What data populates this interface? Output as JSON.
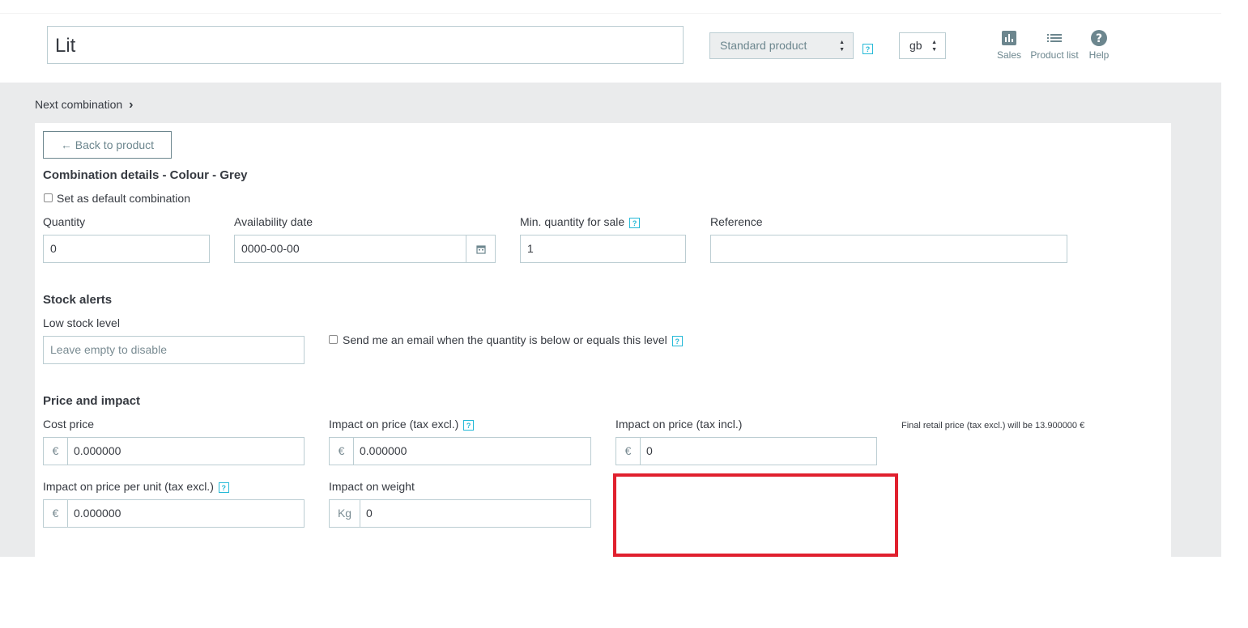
{
  "header": {
    "product_name": "Lit",
    "product_type": "Standard product",
    "language": "gb",
    "tools": {
      "sales": "Sales",
      "product_list": "Product list",
      "help": "Help"
    },
    "help_marker": "?"
  },
  "nav": {
    "next_combination": "Next combination"
  },
  "form": {
    "back_button": "Back to product",
    "combination_title": "Combination details - Colour - Grey",
    "default_combination_label": "Set as default combination",
    "quantity": {
      "label": "Quantity",
      "value": "0"
    },
    "availability_date": {
      "label": "Availability date",
      "value": "0000-00-00"
    },
    "min_quantity": {
      "label": "Min. quantity for sale",
      "value": "1"
    },
    "reference": {
      "label": "Reference",
      "value": ""
    },
    "stock_alerts": {
      "title": "Stock alerts",
      "low_stock_label": "Low stock level",
      "low_stock_placeholder": "Leave empty to disable",
      "email_alert_label": "Send me an email when the quantity is below or equals this level"
    },
    "price": {
      "title": "Price and impact",
      "currency_symbol": "€",
      "weight_unit": "Kg",
      "cost_price": {
        "label": "Cost price",
        "value": "0.000000"
      },
      "impact_tax_excl": {
        "label": "Impact on price (tax excl.)",
        "value": "0.000000"
      },
      "impact_tax_incl": {
        "label": "Impact on price (tax incl.)",
        "value": "0"
      },
      "final_price_note": "Final retail price (tax excl.) will be 13.900000 €",
      "impact_per_unit": {
        "label": "Impact on price per unit (tax excl.)",
        "value": "0.000000"
      },
      "impact_weight": {
        "label": "Impact on weight",
        "value": "0"
      }
    }
  },
  "colors": {
    "accent": "#25b9d7",
    "highlight_box": "#e0202e",
    "background": "#eaebec"
  }
}
